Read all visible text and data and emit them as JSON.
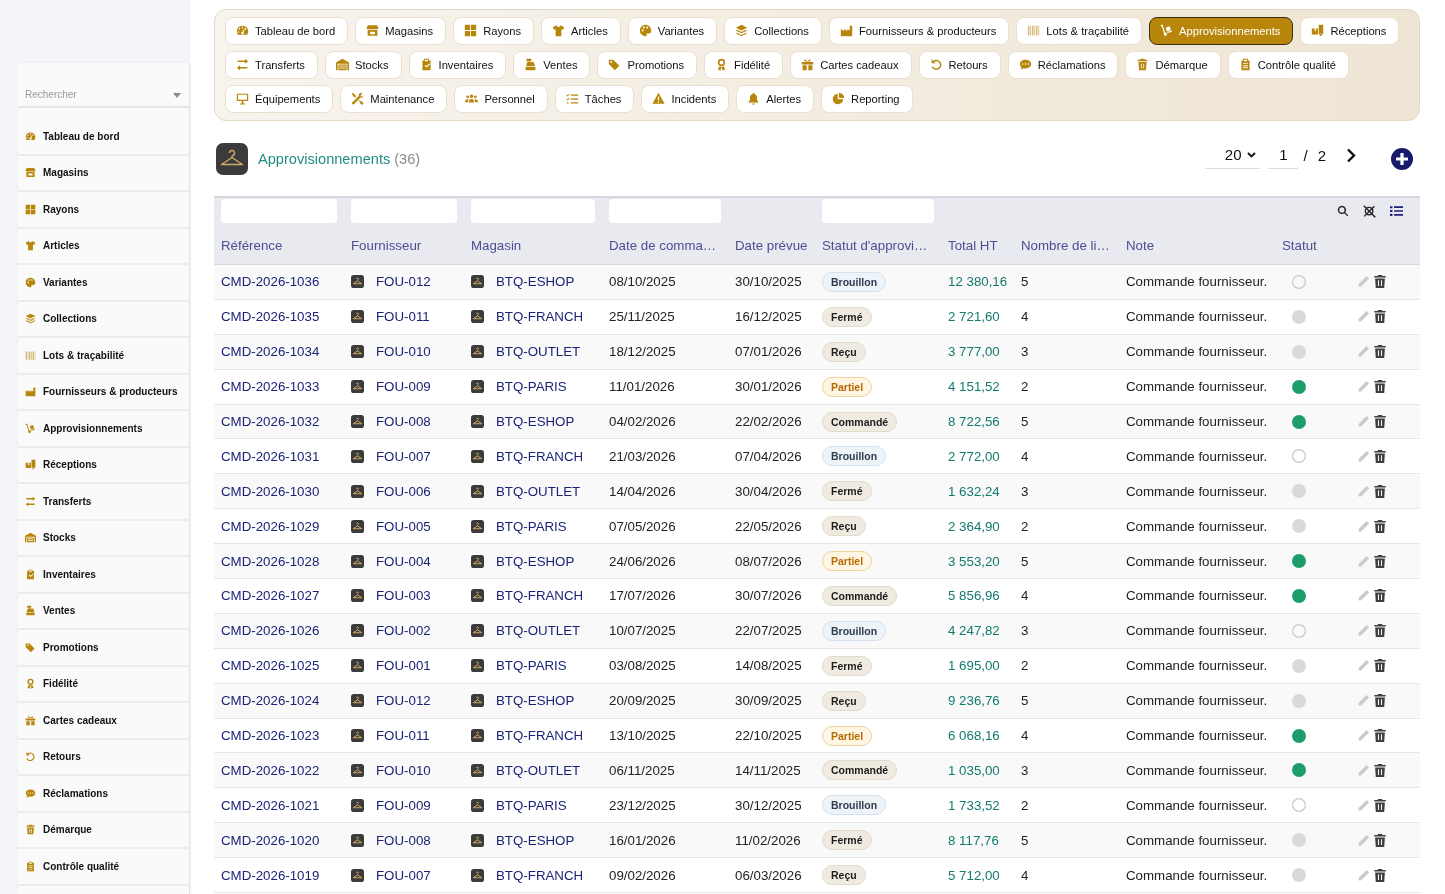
{
  "sidebar": {
    "search": {
      "placeholder": "Rechercher"
    },
    "items": [
      {
        "label": "Tableau de bord"
      },
      {
        "label": "Magasins"
      },
      {
        "label": "Rayons"
      },
      {
        "label": "Articles"
      },
      {
        "label": "Variantes"
      },
      {
        "label": "Collections"
      },
      {
        "label": "Lots & traçabilité"
      },
      {
        "label": "Fournisseurs & producteurs"
      },
      {
        "label": "Approvisionnements"
      },
      {
        "label": "Réceptions"
      },
      {
        "label": "Transferts"
      },
      {
        "label": "Stocks"
      },
      {
        "label": "Inventaires"
      },
      {
        "label": "Ventes"
      },
      {
        "label": "Promotions"
      },
      {
        "label": "Fidélité"
      },
      {
        "label": "Cartes cadeaux"
      },
      {
        "label": "Retours"
      },
      {
        "label": "Réclamations"
      },
      {
        "label": "Démarque"
      },
      {
        "label": "Contrôle qualité"
      }
    ]
  },
  "nav": {
    "tabs": [
      {
        "label": "Tableau de bord",
        "selected": false
      },
      {
        "label": "Magasins",
        "selected": false
      },
      {
        "label": "Rayons",
        "selected": false
      },
      {
        "label": "Articles",
        "selected": false
      },
      {
        "label": "Variantes",
        "selected": false
      },
      {
        "label": "Collections",
        "selected": false
      },
      {
        "label": "Fournisseurs & producteurs",
        "selected": false
      },
      {
        "label": "Lots & traçabilité",
        "selected": false
      },
      {
        "label": "Approvisionnements",
        "selected": true
      },
      {
        "label": "Réceptions",
        "selected": false
      },
      {
        "label": "Transferts",
        "selected": false
      },
      {
        "label": "Stocks",
        "selected": false
      },
      {
        "label": "Inventaires",
        "selected": false
      },
      {
        "label": "Ventes",
        "selected": false
      },
      {
        "label": "Promotions",
        "selected": false
      },
      {
        "label": "Fidélité",
        "selected": false
      },
      {
        "label": "Cartes cadeaux",
        "selected": false
      },
      {
        "label": "Retours",
        "selected": false
      },
      {
        "label": "Réclamations",
        "selected": false
      },
      {
        "label": "Démarque",
        "selected": false
      },
      {
        "label": "Contrôle qualité",
        "selected": false
      },
      {
        "label": "Équipements",
        "selected": false
      },
      {
        "label": "Maintenance",
        "selected": false
      },
      {
        "label": "Personnel",
        "selected": false
      },
      {
        "label": "Tâches",
        "selected": false
      },
      {
        "label": "Incidents",
        "selected": false
      },
      {
        "label": "Alertes",
        "selected": false
      },
      {
        "label": "Reporting",
        "selected": false
      }
    ]
  },
  "header": {
    "title": "Approvisionnements",
    "count": "(36)"
  },
  "pagination": {
    "page_size": "20",
    "page": "1",
    "separator": "/",
    "total_pages": "2"
  },
  "table": {
    "columns": [
      {
        "label": "Référence",
        "filter": true
      },
      {
        "label": "Fournisseur",
        "filter": true
      },
      {
        "label": "Magasin",
        "filter": true
      },
      {
        "label": "Date de comma…",
        "filter": true
      },
      {
        "label": "Date prévue",
        "filter": false
      },
      {
        "label": "Statut d'approvi…",
        "filter": true
      },
      {
        "label": "Total HT",
        "filter": false
      },
      {
        "label": "Nombre de li…",
        "filter": false
      },
      {
        "label": "Note",
        "filter": false
      },
      {
        "label": "Statut",
        "filter": false
      }
    ],
    "rows": [
      {
        "reference": "CMD-2026-1036",
        "supplier": "FOU-012",
        "store": "BTQ-ESHOP",
        "order_date": "08/10/2025",
        "expected_date": "30/10/2025",
        "supply_status": {
          "label": "Brouillon",
          "kind": "draft"
        },
        "total": "12 380,16",
        "line_count": "5",
        "note": "Commande fournisseur.",
        "status": {
          "filled": false,
          "color": "#c8c8c8"
        }
      },
      {
        "reference": "CMD-2026-1035",
        "supplier": "FOU-011",
        "store": "BTQ-FRANCH",
        "order_date": "25/11/2025",
        "expected_date": "16/12/2025",
        "supply_status": {
          "label": "Fermé",
          "kind": "plain"
        },
        "total": "2 721,60",
        "line_count": "4",
        "note": "Commande fournisseur.",
        "status": {
          "filled": true,
          "color": "#d9d9d9"
        }
      },
      {
        "reference": "CMD-2026-1034",
        "supplier": "FOU-010",
        "store": "BTQ-OUTLET",
        "order_date": "18/12/2025",
        "expected_date": "07/01/2026",
        "supply_status": {
          "label": "Reçu",
          "kind": "plain"
        },
        "total": "3 777,00",
        "line_count": "3",
        "note": "Commande fournisseur.",
        "status": {
          "filled": true,
          "color": "#d9d9d9"
        }
      },
      {
        "reference": "CMD-2026-1033",
        "supplier": "FOU-009",
        "store": "BTQ-PARIS",
        "order_date": "11/01/2026",
        "expected_date": "30/01/2026",
        "supply_status": {
          "label": "Partiel",
          "kind": "warning"
        },
        "total": "4 151,52",
        "line_count": "2",
        "note": "Commande fournisseur.",
        "status": {
          "filled": true,
          "color": "#1e9d6c"
        }
      },
      {
        "reference": "CMD-2026-1032",
        "supplier": "FOU-008",
        "store": "BTQ-ESHOP",
        "order_date": "04/02/2026",
        "expected_date": "22/02/2026",
        "supply_status": {
          "label": "Commandé",
          "kind": "plain"
        },
        "total": "8 722,56",
        "line_count": "5",
        "note": "Commande fournisseur.",
        "status": {
          "filled": true,
          "color": "#1e9d6c"
        }
      },
      {
        "reference": "CMD-2026-1031",
        "supplier": "FOU-007",
        "store": "BTQ-FRANCH",
        "order_date": "21/03/2026",
        "expected_date": "07/04/2026",
        "supply_status": {
          "label": "Brouillon",
          "kind": "draft"
        },
        "total": "2 772,00",
        "line_count": "4",
        "note": "Commande fournisseur.",
        "status": {
          "filled": false,
          "color": "#c8c8c8"
        }
      },
      {
        "reference": "CMD-2026-1030",
        "supplier": "FOU-006",
        "store": "BTQ-OUTLET",
        "order_date": "14/04/2026",
        "expected_date": "30/04/2026",
        "supply_status": {
          "label": "Fermé",
          "kind": "plain"
        },
        "total": "1 632,24",
        "line_count": "3",
        "note": "Commande fournisseur.",
        "status": {
          "filled": true,
          "color": "#d9d9d9"
        }
      },
      {
        "reference": "CMD-2026-1029",
        "supplier": "FOU-005",
        "store": "BTQ-PARIS",
        "order_date": "07/05/2026",
        "expected_date": "22/05/2026",
        "supply_status": {
          "label": "Reçu",
          "kind": "plain"
        },
        "total": "2 364,90",
        "line_count": "2",
        "note": "Commande fournisseur.",
        "status": {
          "filled": true,
          "color": "#d9d9d9"
        }
      },
      {
        "reference": "CMD-2026-1028",
        "supplier": "FOU-004",
        "store": "BTQ-ESHOP",
        "order_date": "24/06/2026",
        "expected_date": "08/07/2026",
        "supply_status": {
          "label": "Partiel",
          "kind": "warning"
        },
        "total": "3 553,20",
        "line_count": "5",
        "note": "Commande fournisseur.",
        "status": {
          "filled": true,
          "color": "#1e9d6c"
        }
      },
      {
        "reference": "CMD-2026-1027",
        "supplier": "FOU-003",
        "store": "BTQ-FRANCH",
        "order_date": "17/07/2026",
        "expected_date": "30/07/2026",
        "supply_status": {
          "label": "Commandé",
          "kind": "plain"
        },
        "total": "5 856,96",
        "line_count": "4",
        "note": "Commande fournisseur.",
        "status": {
          "filled": true,
          "color": "#1e9d6c"
        }
      },
      {
        "reference": "CMD-2026-1026",
        "supplier": "FOU-002",
        "store": "BTQ-OUTLET",
        "order_date": "10/07/2025",
        "expected_date": "22/07/2025",
        "supply_status": {
          "label": "Brouillon",
          "kind": "draft"
        },
        "total": "4 247,82",
        "line_count": "3",
        "note": "Commande fournisseur.",
        "status": {
          "filled": false,
          "color": "#c8c8c8"
        }
      },
      {
        "reference": "CMD-2026-1025",
        "supplier": "FOU-001",
        "store": "BTQ-PARIS",
        "order_date": "03/08/2025",
        "expected_date": "14/08/2025",
        "supply_status": {
          "label": "Fermé",
          "kind": "plain"
        },
        "total": "1 695,00",
        "line_count": "2",
        "note": "Commande fournisseur.",
        "status": {
          "filled": true,
          "color": "#d9d9d9"
        }
      },
      {
        "reference": "CMD-2026-1024",
        "supplier": "FOU-012",
        "store": "BTQ-ESHOP",
        "order_date": "20/09/2025",
        "expected_date": "30/09/2025",
        "supply_status": {
          "label": "Reçu",
          "kind": "plain"
        },
        "total": "9 236,76",
        "line_count": "5",
        "note": "Commande fournisseur.",
        "status": {
          "filled": true,
          "color": "#d9d9d9"
        }
      },
      {
        "reference": "CMD-2026-1023",
        "supplier": "FOU-011",
        "store": "BTQ-FRANCH",
        "order_date": "13/10/2025",
        "expected_date": "22/10/2025",
        "supply_status": {
          "label": "Partiel",
          "kind": "warning"
        },
        "total": "6 068,16",
        "line_count": "4",
        "note": "Commande fournisseur.",
        "status": {
          "filled": true,
          "color": "#1e9d6c"
        }
      },
      {
        "reference": "CMD-2026-1022",
        "supplier": "FOU-010",
        "store": "BTQ-OUTLET",
        "order_date": "06/11/2025",
        "expected_date": "14/11/2025",
        "supply_status": {
          "label": "Commandé",
          "kind": "plain"
        },
        "total": "1 035,00",
        "line_count": "3",
        "note": "Commande fournisseur.",
        "status": {
          "filled": true,
          "color": "#1e9d6c"
        }
      },
      {
        "reference": "CMD-2026-1021",
        "supplier": "FOU-009",
        "store": "BTQ-PARIS",
        "order_date": "23/12/2025",
        "expected_date": "30/12/2025",
        "supply_status": {
          "label": "Brouillon",
          "kind": "draft"
        },
        "total": "1 733,52",
        "line_count": "2",
        "note": "Commande fournisseur.",
        "status": {
          "filled": false,
          "color": "#c8c8c8"
        }
      },
      {
        "reference": "CMD-2026-1020",
        "supplier": "FOU-008",
        "store": "BTQ-ESHOP",
        "order_date": "16/01/2026",
        "expected_date": "11/02/2026",
        "supply_status": {
          "label": "Fermé",
          "kind": "plain"
        },
        "total": "8 117,76",
        "line_count": "5",
        "note": "Commande fournisseur.",
        "status": {
          "filled": true,
          "color": "#d9d9d9"
        }
      },
      {
        "reference": "CMD-2026-1019",
        "supplier": "FOU-007",
        "store": "BTQ-FRANCH",
        "order_date": "09/02/2026",
        "expected_date": "06/03/2026",
        "supply_status": {
          "label": "Reçu",
          "kind": "plain"
        },
        "total": "5 712,00",
        "line_count": "4",
        "note": "Commande fournisseur.",
        "status": {
          "filled": true,
          "color": "#d9d9d9"
        }
      }
    ]
  }
}
